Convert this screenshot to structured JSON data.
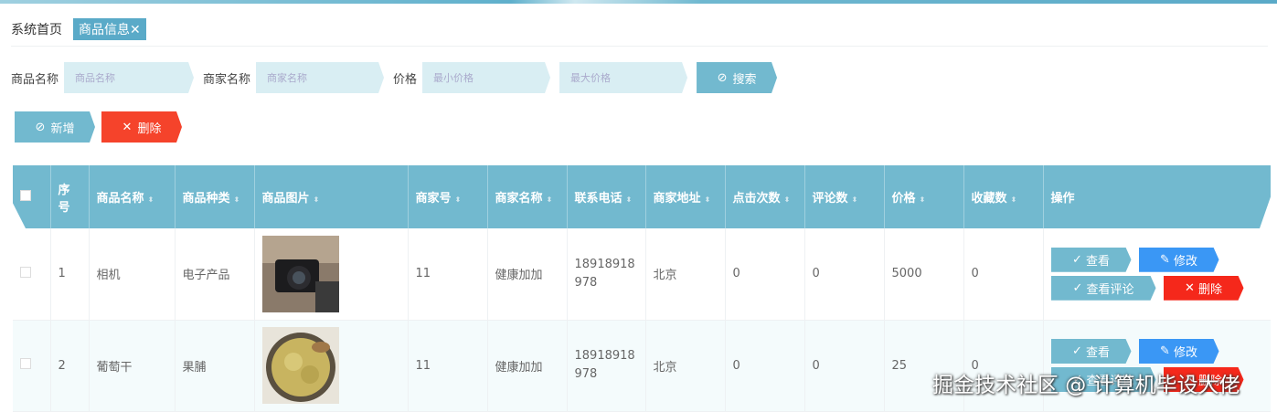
{
  "tabs": {
    "home": "系统首页",
    "active": "商品信息",
    "close": "✕"
  },
  "search": {
    "name_label": "商品名称",
    "name_placeholder": "商品名称",
    "merchant_label": "商家名称",
    "merchant_placeholder": "商家名称",
    "price_label": "价格",
    "min_placeholder": "最小价格",
    "max_placeholder": "最大价格",
    "search_btn": "搜索"
  },
  "actions": {
    "add": "新增",
    "delete": "删除"
  },
  "table": {
    "headers": [
      "序号",
      "商品名称",
      "商品种类",
      "商品图片",
      "商家号",
      "商家名称",
      "联系电话",
      "商家地址",
      "点击次数",
      "评论数",
      "价格",
      "收藏数",
      "操作"
    ],
    "rows": [
      {
        "no": "1",
        "name": "相机",
        "category": "电子产品",
        "merchant_no": "11",
        "merchant_name": "健康加加",
        "phone": "18918918978",
        "address": "北京",
        "clicks": "0",
        "comments": "0",
        "price": "5000",
        "favorites": "0"
      },
      {
        "no": "2",
        "name": "葡萄干",
        "category": "果脯",
        "merchant_no": "11",
        "merchant_name": "健康加加",
        "phone": "18918918978",
        "address": "北京",
        "clicks": "0",
        "comments": "0",
        "price": "25",
        "favorites": "0"
      }
    ],
    "row_actions": {
      "view": "查看",
      "edit": "修改",
      "view_comments": "查看评论",
      "delete": "删除"
    }
  },
  "watermark": "掘金技术社区 @ 计算机毕设大佬",
  "colors": {
    "primary": "#72b9cf",
    "edit": "#3a97f5",
    "danger": "#f5281b",
    "input": "#d9eef3"
  }
}
